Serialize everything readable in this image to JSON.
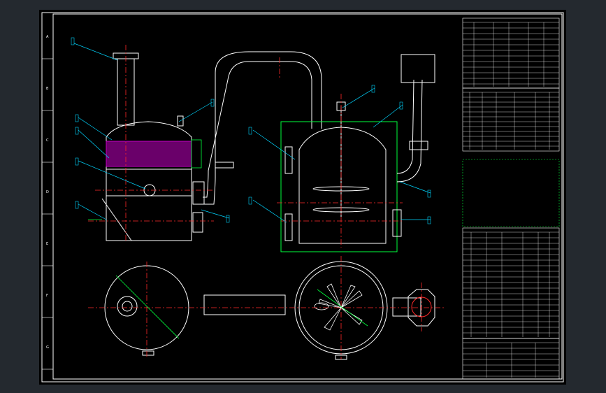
{
  "zone_letters_left": [
    "A",
    "B",
    "C",
    "D",
    "E",
    "F",
    "G"
  ],
  "zone_numbers_top": [
    "1",
    "2",
    "3",
    "4",
    "5",
    "6",
    "7",
    "8"
  ],
  "leader_labels": [
    "1",
    "2",
    "3",
    "4",
    "5",
    "6",
    "7",
    "8",
    "9",
    "10",
    "11",
    "12",
    "13",
    "14",
    "15",
    "16",
    "17",
    "18"
  ],
  "colors": {
    "outline": "#ffffff",
    "centerline": "#ff2a2a",
    "leader": "#00d5ff",
    "frame": "#00ff3c",
    "packing": "#c000c0",
    "pipe_label": "#3cff3c",
    "dimension": "#e6e600"
  },
  "icons": [
    "vessel-icon",
    "pipe-icon",
    "nozzle-icon"
  ]
}
